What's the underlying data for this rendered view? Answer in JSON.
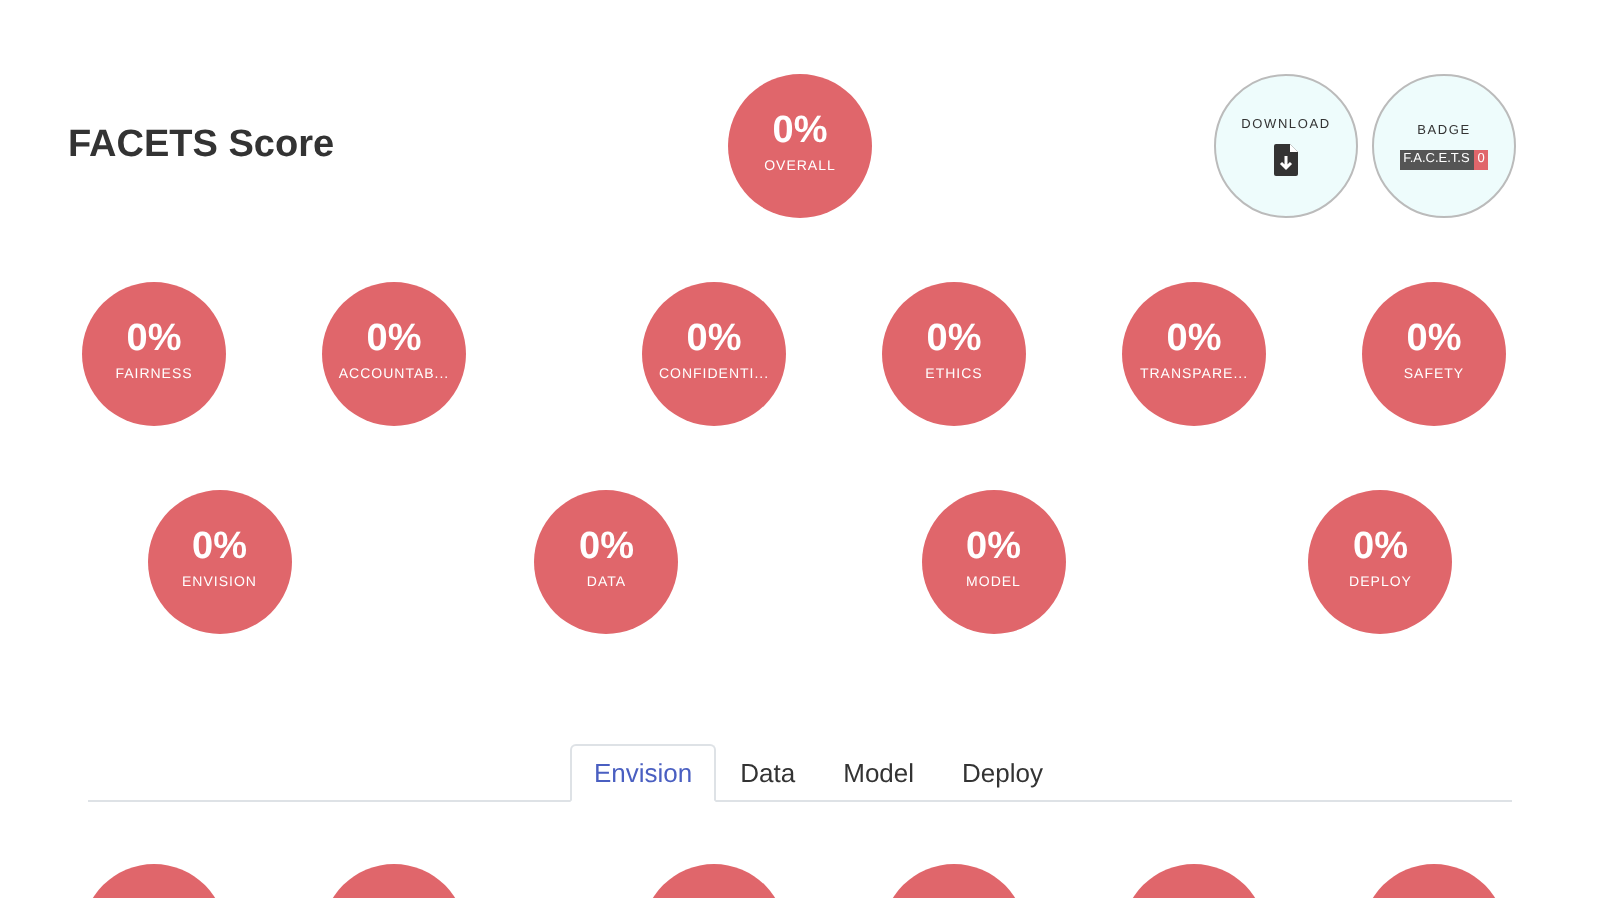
{
  "title": "FACETS Score",
  "overall": {
    "value": "0%",
    "label": "OVERALL"
  },
  "actions": [
    {
      "kind": "download",
      "label": "DOWNLOAD"
    },
    {
      "kind": "badge",
      "label": "BADGE",
      "badge_text": "F.A.C.E.T.S",
      "badge_count": "0"
    }
  ],
  "facets": [
    {
      "value": "0%",
      "label": "FAIRNESS"
    },
    {
      "value": "0%",
      "label": "ACCOUNTAB..."
    },
    {
      "value": "0%",
      "label": "CONFIDENTI..."
    },
    {
      "value": "0%",
      "label": "ETHICS"
    },
    {
      "value": "0%",
      "label": "TRANSPARE..."
    },
    {
      "value": "0%",
      "label": "SAFETY"
    }
  ],
  "stages": [
    {
      "value": "0%",
      "label": "ENVISION"
    },
    {
      "value": "0%",
      "label": "DATA"
    },
    {
      "value": "0%",
      "label": "MODEL"
    },
    {
      "value": "0%",
      "label": "DEPLOY"
    }
  ],
  "tabs": [
    {
      "label": "Envision",
      "selected": true
    },
    {
      "label": "Data",
      "selected": false
    },
    {
      "label": "Model",
      "selected": false
    },
    {
      "label": "Deploy",
      "selected": false
    }
  ],
  "tab_panel_circles": [
    {
      "kind": "score"
    },
    {
      "kind": "score"
    },
    {
      "kind": "score"
    },
    {
      "kind": "score"
    },
    {
      "kind": "score"
    },
    {
      "kind": "score"
    }
  ]
}
